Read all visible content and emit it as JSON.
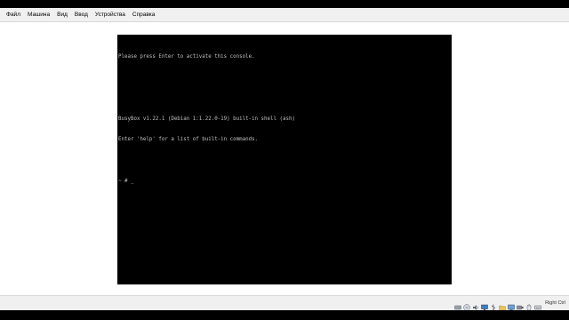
{
  "menubar": {
    "items": [
      "Файл",
      "Машина",
      "Вид",
      "Ввод",
      "Устройства",
      "Справка"
    ]
  },
  "console": {
    "lines": [
      "Please press Enter to activate this console.",
      "",
      "",
      "BusyBox v1.22.1 (Debian 1:1.22.0-19) built-in shell (ash)",
      "Enter 'help' for a list of built-in commands.",
      "",
      "~ # _"
    ]
  },
  "statusbar": {
    "icons": [
      "hard-disk-icon",
      "optical-drive-icon",
      "audio-icon",
      "network-icon",
      "usb-icon",
      "shared-folder-icon",
      "display-icon",
      "video-capture-icon",
      "mouse-integration-icon",
      "keyboard-capture-icon"
    ],
    "host_key": "Right Ctrl"
  },
  "colors": {
    "console_bg": "#000000",
    "console_text": "#c0c0c0",
    "vm_bg": "#ffffff",
    "bar_bg": "#f0f0f0"
  }
}
